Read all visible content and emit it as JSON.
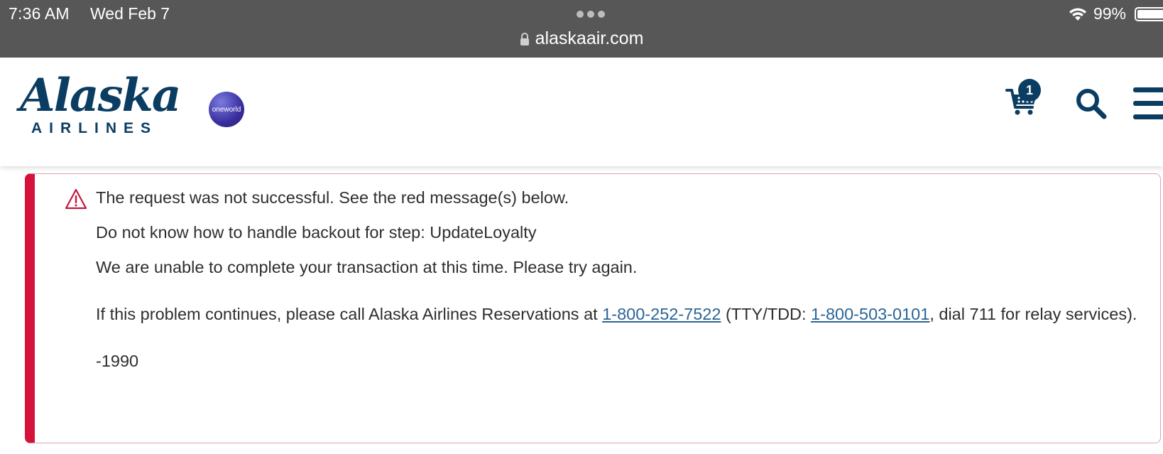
{
  "status_bar": {
    "time": "7:36 AM",
    "date": "Wed Feb 7",
    "battery": "99%"
  },
  "browser": {
    "url": "alaskaair.com"
  },
  "header": {
    "logo_word": "Alaska",
    "logo_sub": "AIRLINES",
    "oneworld_label": "oneworld",
    "cart_count": "1"
  },
  "alert": {
    "line1": "The request was not successful. See the red message(s) below.",
    "line2": "Do not know how to handle backout for step: UpdateLoyalty",
    "line3": "We are unable to complete your transaction at this time. Please try again.",
    "line4_part1": "If this problem continues, please call Alaska Airlines Reservations at ",
    "phone1": "1-800-252-7522",
    "line4_part2": " (TTY/TDD: ",
    "phone2": "1-800-503-0101",
    "line4_part3": ", dial 711 for relay services).",
    "code": "-1990"
  },
  "colors": {
    "brand_navy": "#0b3d63",
    "alert_red": "#d4123b",
    "link_blue": "#2a6496",
    "topbar_gray": "#575757"
  }
}
